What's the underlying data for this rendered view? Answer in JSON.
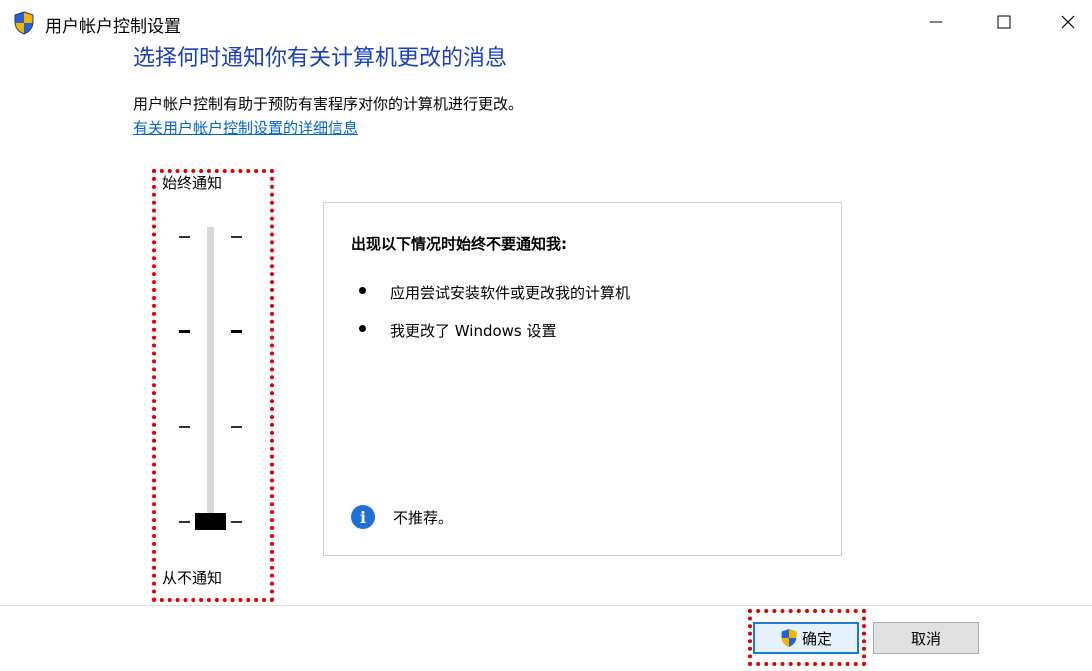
{
  "window": {
    "title": "用户帐户控制设置",
    "icon": "uac-shield-icon"
  },
  "header": {
    "heading": "选择何时通知你有关计算机更改的消息",
    "description": "用户帐户控制有助于预防有害程序对你的计算机进行更改。",
    "link": "有关用户帐户控制设置的详细信息"
  },
  "slider": {
    "top_label": "始终通知",
    "bottom_label": "从不通知",
    "levels": 4,
    "selected_level": 1
  },
  "panel": {
    "heading": "出现以下情况时始终不要通知我:",
    "items": [
      "应用尝试安装软件或更改我的计算机",
      "我更改了 Windows 设置"
    ],
    "note": "不推荐。"
  },
  "buttons": {
    "ok": "确定",
    "cancel": "取消"
  },
  "colors": {
    "heading": "#1a3fbf",
    "link": "#0066cc",
    "annotation": "#e00000",
    "info": "#1e6fd6"
  }
}
